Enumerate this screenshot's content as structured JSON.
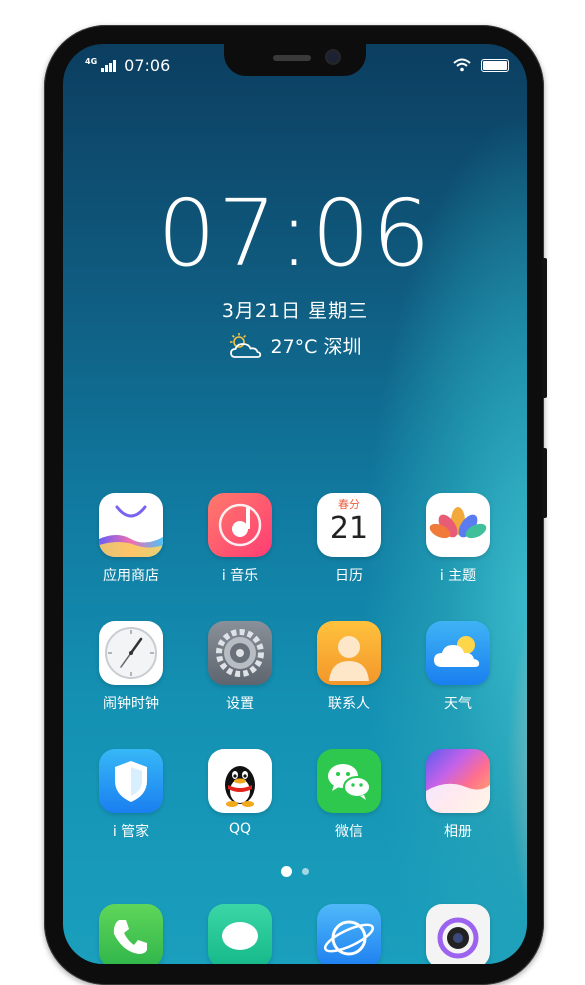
{
  "status_bar": {
    "network": "4G",
    "time": "07:06"
  },
  "lockscreen": {
    "time": "07:06",
    "date": "3月21日  星期三",
    "weather": "27°C 深圳"
  },
  "apps": [
    {
      "label": "应用商店",
      "icon": "app-store-icon"
    },
    {
      "label": "i 音乐",
      "icon": "music-icon"
    },
    {
      "label": "日历",
      "icon": "calendar-icon",
      "icon_top": "春分",
      "icon_num": "21"
    },
    {
      "label": "i 主题",
      "icon": "theme-lotus-icon"
    },
    {
      "label": "闹钟时钟",
      "icon": "clock-icon"
    },
    {
      "label": "设置",
      "icon": "settings-gear-icon"
    },
    {
      "label": "联系人",
      "icon": "contacts-icon"
    },
    {
      "label": "天气",
      "icon": "weather-cloud-icon"
    },
    {
      "label": "i 管家",
      "icon": "security-shield-icon"
    },
    {
      "label": "QQ",
      "icon": "qq-penguin-icon"
    },
    {
      "label": "微信",
      "icon": "wechat-icon"
    },
    {
      "label": "相册",
      "icon": "gallery-icon"
    }
  ],
  "dock": [
    {
      "icon": "phone-icon"
    },
    {
      "icon": "messages-icon"
    },
    {
      "icon": "browser-icon"
    },
    {
      "icon": "camera-icon"
    }
  ],
  "colors": {
    "accent_orange": "#f0a21c",
    "accent_blue": "#2d8cf0",
    "wechat_green": "#2dc84d"
  }
}
